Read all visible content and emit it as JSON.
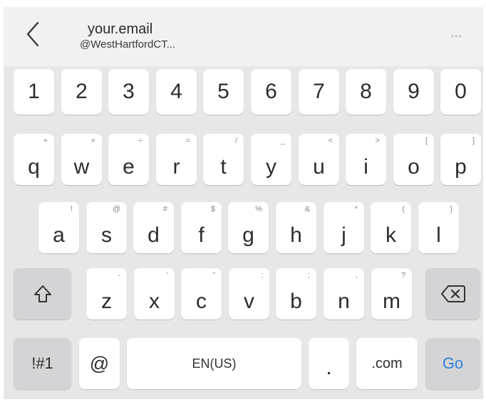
{
  "header": {
    "title": "your.email",
    "subtitle": "@WestHartfordCT...",
    "more_label": "•••"
  },
  "keyboard": {
    "number_row": [
      "1",
      "2",
      "3",
      "4",
      "5",
      "6",
      "7",
      "8",
      "9",
      "0"
    ],
    "row1": [
      {
        "main": "q",
        "hint": "+"
      },
      {
        "main": "w",
        "hint": "×"
      },
      {
        "main": "e",
        "hint": "÷"
      },
      {
        "main": "r",
        "hint": "="
      },
      {
        "main": "t",
        "hint": "/"
      },
      {
        "main": "y",
        "hint": "_"
      },
      {
        "main": "u",
        "hint": "<"
      },
      {
        "main": "i",
        "hint": ">"
      },
      {
        "main": "o",
        "hint": "["
      },
      {
        "main": "p",
        "hint": "]"
      }
    ],
    "row2": [
      {
        "main": "a",
        "hint": "!"
      },
      {
        "main": "s",
        "hint": "@"
      },
      {
        "main": "d",
        "hint": "#"
      },
      {
        "main": "f",
        "hint": "$"
      },
      {
        "main": "g",
        "hint": "%"
      },
      {
        "main": "h",
        "hint": "&"
      },
      {
        "main": "j",
        "hint": "*"
      },
      {
        "main": "k",
        "hint": "("
      },
      {
        "main": "l",
        "hint": ")"
      }
    ],
    "row3": [
      {
        "main": "z",
        "hint": "-"
      },
      {
        "main": "x",
        "hint": "'"
      },
      {
        "main": "c",
        "hint": "\""
      },
      {
        "main": "v",
        "hint": ":"
      },
      {
        "main": "b",
        "hint": ";"
      },
      {
        "main": "n",
        "hint": ","
      },
      {
        "main": "m",
        "hint": "?"
      }
    ],
    "bottom": {
      "symbols": "!#1",
      "at": "@",
      "space": "EN(US)",
      "period": ".",
      "dotcom": ".com",
      "go": "Go"
    }
  },
  "colors": {
    "keyboard_bg": "#e7e7e8",
    "key_bg": "#ffffff",
    "func_key_bg": "#d4d4d6",
    "go_text": "#2e7fd7"
  },
  "icons": {
    "back": "chevron-left-icon",
    "shift": "shift-arrow-up-icon",
    "backspace": "backspace-icon"
  }
}
